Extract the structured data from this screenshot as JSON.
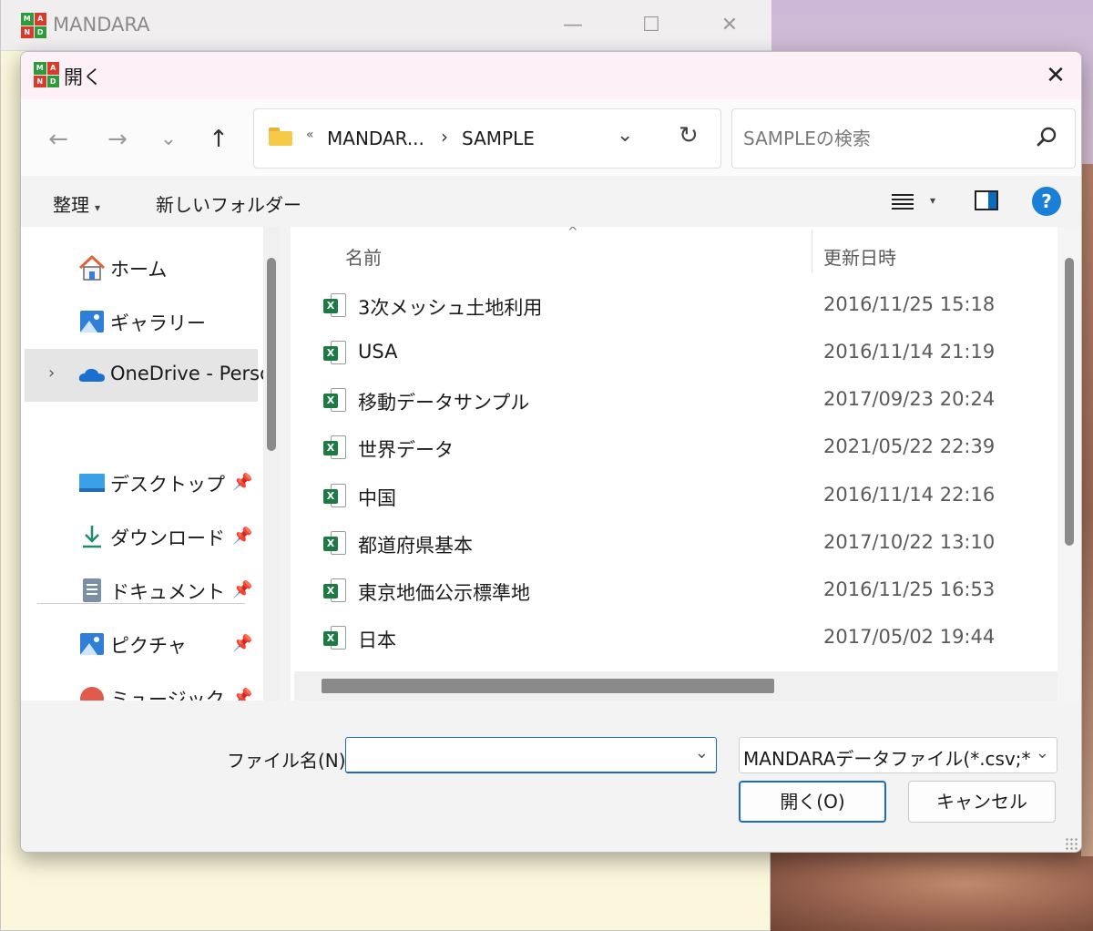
{
  "main_window": {
    "title": "MANDARA",
    "logo_letters": [
      "M",
      "A",
      "N",
      "D"
    ],
    "controls": {
      "minimize": "—",
      "maximize": "☐",
      "close": "✕"
    }
  },
  "dialog": {
    "title": "開く",
    "close": "✕"
  },
  "nav": {
    "back": "←",
    "forward": "→",
    "recent": "⌄",
    "up": "↑"
  },
  "address": {
    "overflow": "«",
    "segments": [
      "MANDAR...",
      "SAMPLE"
    ],
    "separator": "›",
    "dropdown": "⌄",
    "refresh": "↻"
  },
  "search": {
    "placeholder": "SAMPLEの検索"
  },
  "toolbar": {
    "organize": "整理",
    "new_folder": "新しいフォルダー",
    "dropdown": "▾",
    "help": "?"
  },
  "sidebar": {
    "items": [
      {
        "label": "ホーム",
        "icon": "home-icon"
      },
      {
        "label": "ギャラリー",
        "icon": "gallery-icon"
      },
      {
        "label": "OneDrive - Perso",
        "icon": "onedrive-icon",
        "expander": "›",
        "selected": true
      },
      {
        "label": "デスクトップ",
        "icon": "desktop-icon",
        "pinned": true
      },
      {
        "label": "ダウンロード",
        "icon": "download-icon",
        "pinned": true
      },
      {
        "label": "ドキュメント",
        "icon": "documents-icon",
        "pinned": true
      },
      {
        "label": "ピクチャ",
        "icon": "pictures-icon",
        "pinned": true
      },
      {
        "label": "ミュージック",
        "icon": "music-icon",
        "pinned": true
      }
    ],
    "pin_glyph": "📌"
  },
  "filelist": {
    "columns": {
      "name": "名前",
      "modified": "更新日時",
      "sort_caret": "^"
    },
    "file_icon_badge": "X",
    "rows": [
      {
        "name": "3次メッシュ土地利用",
        "modified": "2016/11/25 15:18"
      },
      {
        "name": "USA",
        "modified": "2016/11/14 21:19"
      },
      {
        "name": "移動データサンプル",
        "modified": "2017/09/23 20:24"
      },
      {
        "name": "世界データ",
        "modified": "2021/05/22 22:39"
      },
      {
        "name": "中国",
        "modified": "2016/11/14 22:16"
      },
      {
        "name": "都道府県基本",
        "modified": "2017/10/22 13:10"
      },
      {
        "name": "東京地価公示標準地",
        "modified": "2016/11/25 16:53"
      },
      {
        "name": "日本",
        "modified": "2017/05/02 19:44"
      }
    ]
  },
  "bottom": {
    "filename_label": "ファイル名(N):",
    "filename_value": "",
    "filetype_value": "MANDARAデータファイル(*.csv;*.mdrj)",
    "dropdown": "⌄",
    "open_button": "開く(O)",
    "cancel_button": "キャンセル"
  },
  "colors": {
    "accent": "#1a6bc8",
    "excel_green": "#1d7a45",
    "folder_yellow": "#f7c948"
  }
}
